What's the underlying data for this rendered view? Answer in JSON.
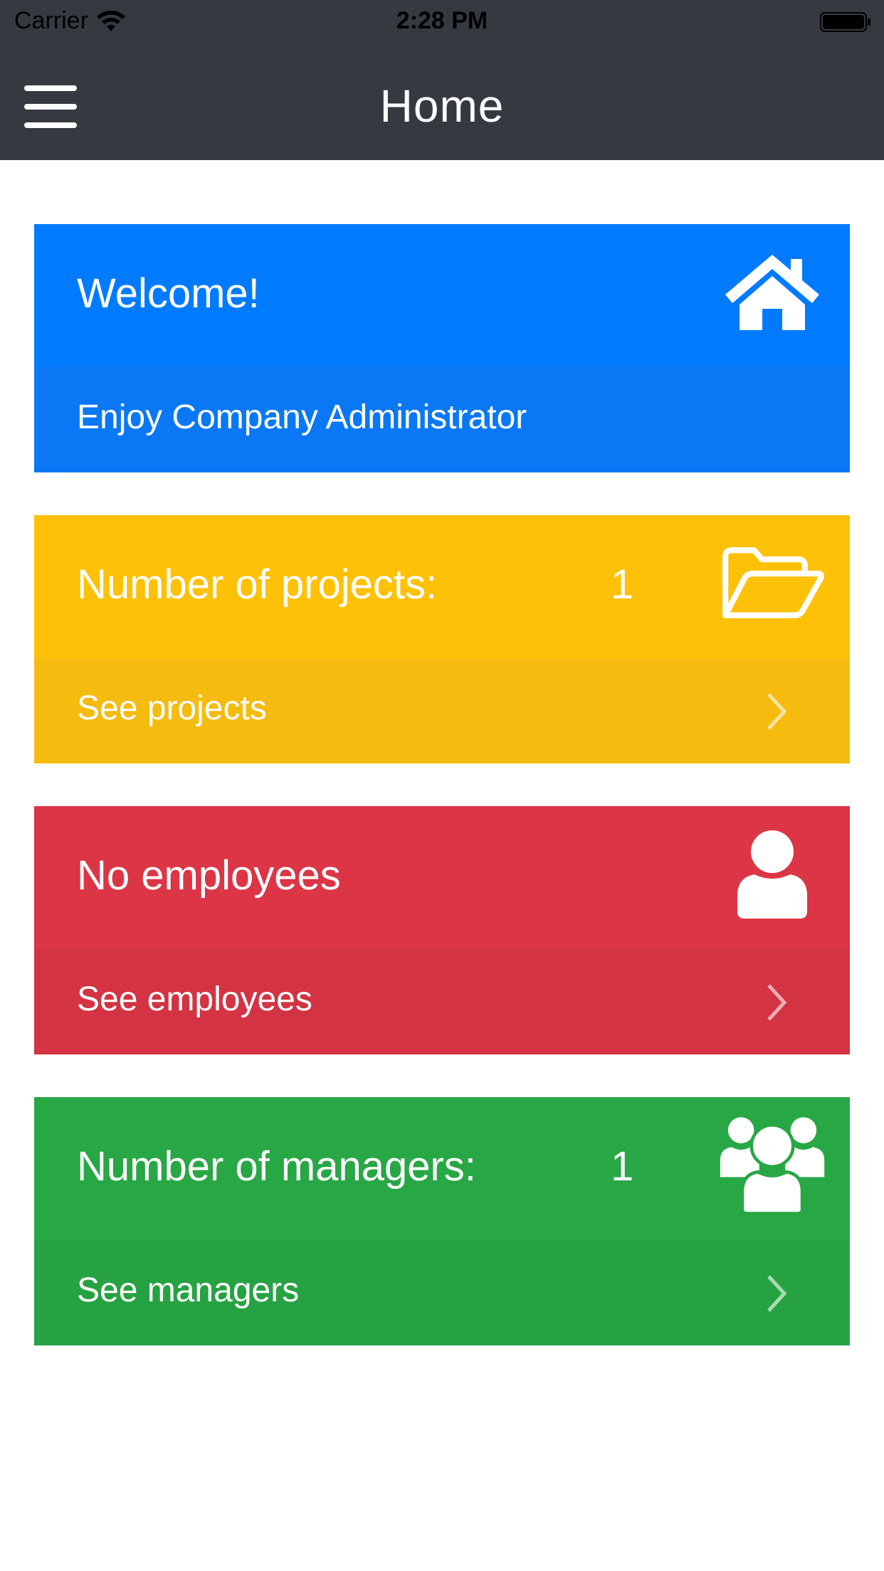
{
  "status_bar": {
    "carrier": "Carrier",
    "time": "2:28 PM",
    "wifi_icon": "wifi-icon",
    "battery_icon": "battery-icon"
  },
  "nav": {
    "title": "Home",
    "menu_icon": "hamburger-menu-icon"
  },
  "cards": {
    "welcome": {
      "title": "Welcome!",
      "subtitle": "Enjoy Company Administrator",
      "icon": "home-icon",
      "color": "#007bff"
    },
    "projects": {
      "title": "Number of projects:",
      "count": "1",
      "link": "See projects",
      "icon": "folder-open-icon",
      "color": "#ffc107"
    },
    "employees": {
      "title": "No employees",
      "link": "See employees",
      "icon": "user-icon",
      "color": "#dc3545"
    },
    "managers": {
      "title": "Number of managers:",
      "count": "1",
      "link": "See managers",
      "icon": "users-icon",
      "color": "#28a745"
    }
  }
}
